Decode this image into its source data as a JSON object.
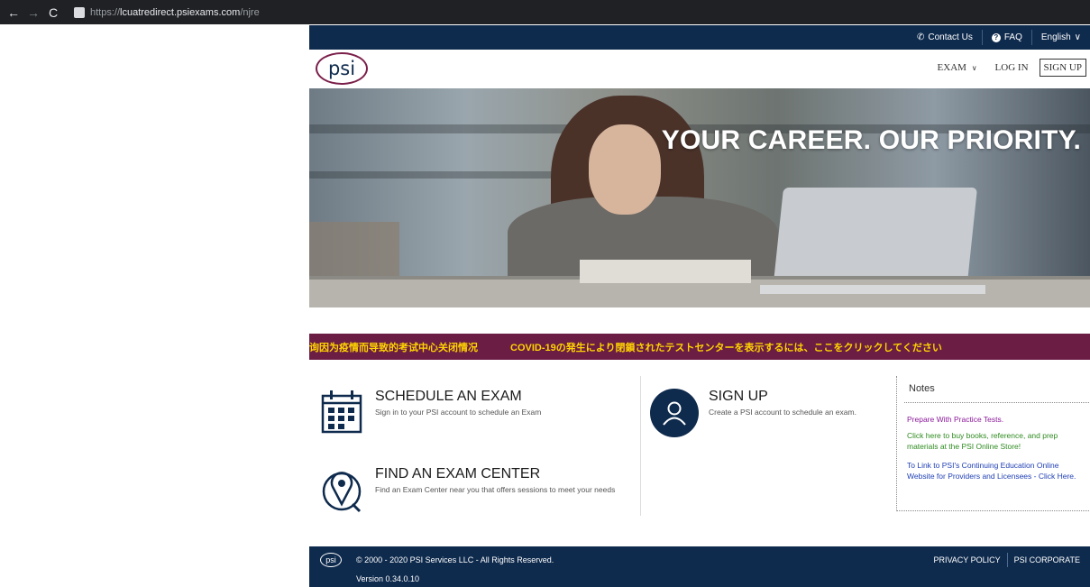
{
  "browser": {
    "url_scheme": "https://",
    "url_host": "lcuatredirect.psiexams.com",
    "url_path": "/njre"
  },
  "topbar": {
    "contact": "Contact Us",
    "faq": "FAQ",
    "language": "English"
  },
  "header": {
    "logo_text": "psi",
    "nav": {
      "exam": "EXAM",
      "login": "LOG IN",
      "signup": "SIGN UP"
    }
  },
  "hero": {
    "tagline": "YOUR CAREER. OUR PRIORITY."
  },
  "banner": {
    "chinese": "询因为疫情而导致的考试中心关闭情况",
    "japanese": "COVID-19の発生により閉鎖されたテストセンターを表示するには、ここをクリックしてください"
  },
  "actions": {
    "schedule": {
      "title": "SCHEDULE AN EXAM",
      "desc": "Sign in to your PSI account to schedule an Exam"
    },
    "signup": {
      "title": "SIGN UP",
      "desc": "Create a PSI account to schedule an exam."
    },
    "find": {
      "title": "FIND AN EXAM CENTER",
      "desc": "Find an Exam Center near you that offers sessions to meet your needs"
    }
  },
  "notes": {
    "title": "Notes",
    "items": [
      {
        "text": "Prepare With Practice Tests.",
        "color": "#8b1a9a"
      },
      {
        "text": "Click here to buy books, reference, and prep materials at the PSI Online Store!",
        "color": "#2e8b1f"
      },
      {
        "text": "To Link to PSI's Continuing Education Online Website for Providers and Licensees - Click Here.",
        "color": "#1f3fb5"
      }
    ]
  },
  "footer": {
    "logo_text": "psi",
    "copyright": "© 2000 - 2020 PSI Services LLC - All Rights Reserved.",
    "version": "Version 0.34.0.10",
    "privacy": "PRIVACY POLICY",
    "corporate": "PSI CORPORATE"
  },
  "colors": {
    "navy": "#0e2a4d",
    "maroon": "#6b1d44",
    "banner_text": "#ffd400",
    "logo_ring": "#7b1f4a"
  }
}
